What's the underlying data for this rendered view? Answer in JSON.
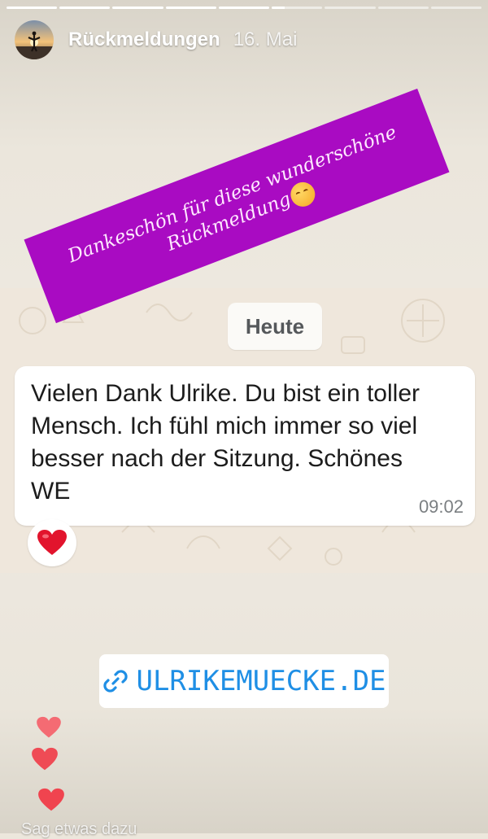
{
  "story": {
    "segments_total": 9,
    "active_segment": 6,
    "active_progress": 0.25,
    "account_name": "Rückmeldungen",
    "date": "16. Mai"
  },
  "sticker": {
    "line1": "Dankeschön für diese wunderschöne",
    "line2": "Rückmeldung",
    "emoji": "smiling-face-with-hearts",
    "color": "#a90bc2"
  },
  "chat": {
    "date_chip": "Heute",
    "message": "Vielen Dank Ulrike. Du bist ein toller Mensch. Ich fühl mich immer so viel besser nach der Sitzung. Schönes WE",
    "time": "09:02",
    "reaction": "red-heart"
  },
  "link": {
    "icon": "link-icon",
    "label": "ULRIKEMUECKE.DE",
    "color": "#1f8fe5"
  },
  "footer": {
    "reply_placeholder": "Sag etwas dazu",
    "floating_hearts": 3
  }
}
